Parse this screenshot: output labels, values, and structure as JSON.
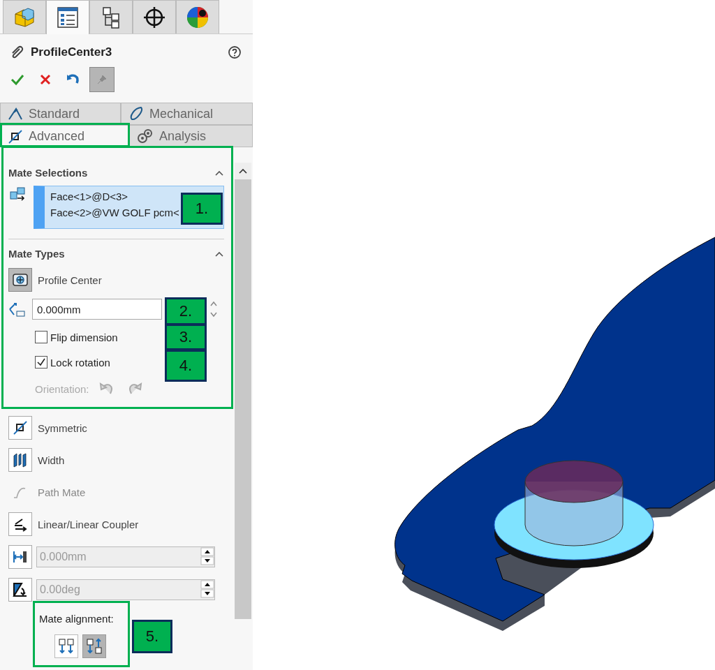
{
  "top_tabs": [
    {
      "kind": "part",
      "selected": false
    },
    {
      "kind": "property",
      "selected": true
    },
    {
      "kind": "config",
      "selected": false
    },
    {
      "kind": "target",
      "selected": false
    },
    {
      "kind": "appearance",
      "selected": false
    }
  ],
  "feature": {
    "title": "ProfileCenter3"
  },
  "action_buttons": [
    {
      "kind": "ok"
    },
    {
      "kind": "cancel"
    },
    {
      "kind": "undo"
    },
    {
      "kind": "pin"
    }
  ],
  "mate_tabs": [
    {
      "kind": "standard",
      "label": "Standard",
      "selected": false
    },
    {
      "kind": "mechanical",
      "label": "Mechanical",
      "selected": false
    },
    {
      "kind": "advanced",
      "label": "Advanced",
      "selected": true
    },
    {
      "kind": "analysis",
      "label": "Analysis",
      "selected": false
    }
  ],
  "mate_selections": {
    "title": "Mate Selections",
    "items": [
      "Face<1>@D<3>",
      "Face<2>@VW GOLF pcm<"
    ]
  },
  "mate_types": {
    "title": "Mate Types",
    "items": [
      {
        "kind": "profile-center",
        "label": "Profile Center",
        "selected": true
      }
    ],
    "distance": "0.000mm",
    "options": [
      {
        "label": "Flip dimension",
        "checked": false
      },
      {
        "label": "Lock rotation",
        "checked": true
      }
    ],
    "orientation": {
      "label": "Orientation:",
      "disabled": true
    }
  },
  "other_types": [
    {
      "kind": "symmetric",
      "label": "Symmetric",
      "disabled": false
    },
    {
      "kind": "width",
      "label": "Width",
      "disabled": false
    },
    {
      "kind": "path",
      "label": "Path Mate",
      "disabled": true
    },
    {
      "kind": "coupler",
      "label": "Linear/Linear Coupler",
      "disabled": false
    }
  ],
  "fields": [
    {
      "kind": "distance",
      "value": "0.000mm",
      "disabled": true
    },
    {
      "kind": "angle",
      "value": "0.00deg",
      "disabled": true
    }
  ],
  "mate_alignment": {
    "label": "Mate alignment:",
    "options": [
      {
        "kind": "aligned",
        "selected": false
      },
      {
        "kind": "anti-aligned",
        "selected": true
      }
    ]
  },
  "callouts": [
    "1.",
    "2.",
    "3.",
    "4.",
    "5."
  ]
}
